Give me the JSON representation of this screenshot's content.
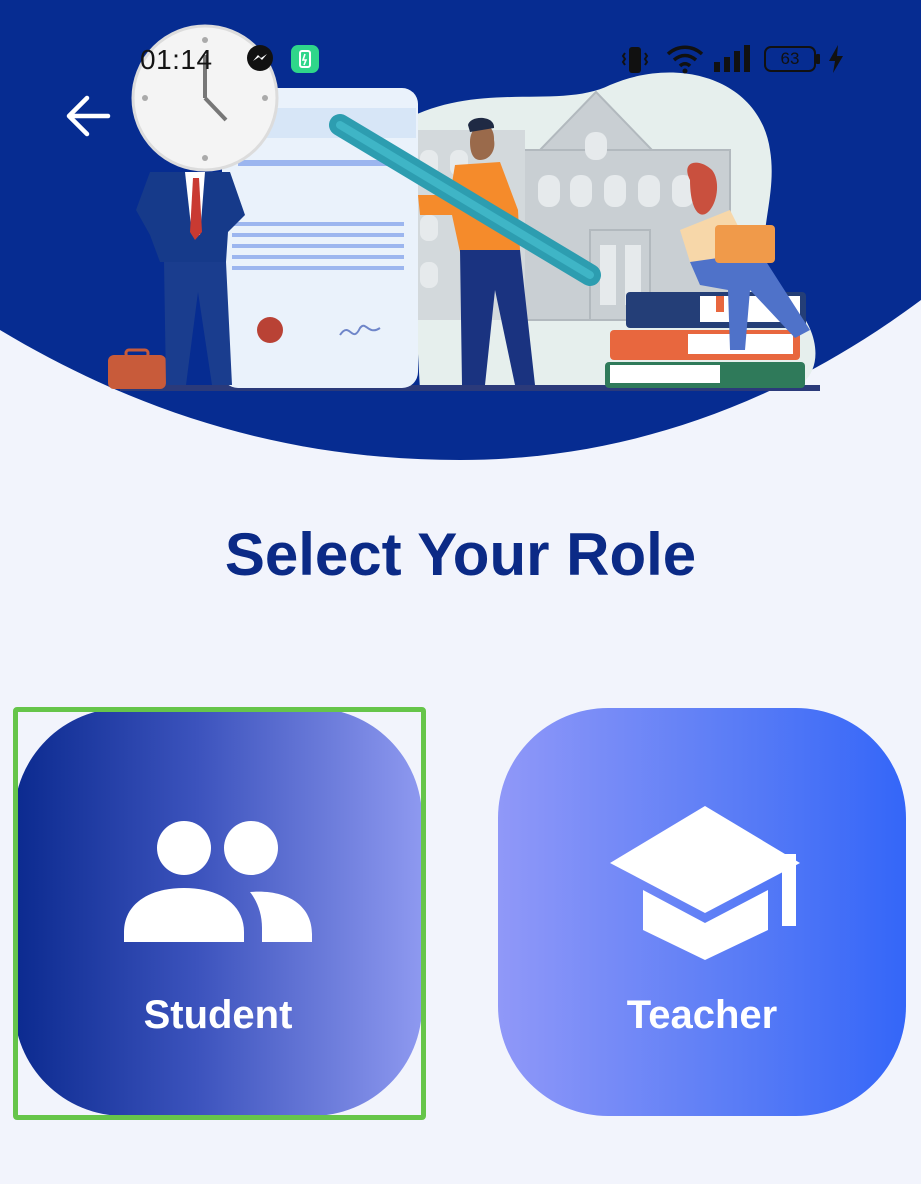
{
  "status_bar": {
    "time": "01:14",
    "battery_level": "63",
    "icons": [
      "messenger-icon",
      "battery-saver-icon",
      "vibrate-icon",
      "wifi-icon",
      "signal-icon",
      "battery-icon",
      "charging-icon"
    ]
  },
  "header": {
    "back_icon": "arrow-left-icon",
    "illustration": "education-illustration"
  },
  "page": {
    "title": "Select Your Role"
  },
  "roles": [
    {
      "label": "Student",
      "icon": "users-icon",
      "selected": true
    },
    {
      "label": "Teacher",
      "icon": "graduation-cap-icon",
      "selected": false
    }
  ],
  "colors": {
    "primary": "#0b2a86",
    "background": "#f2f4fc",
    "hero_blue": "#062c91",
    "selection": "#66c54a",
    "text_on_card": "#ffffff"
  }
}
